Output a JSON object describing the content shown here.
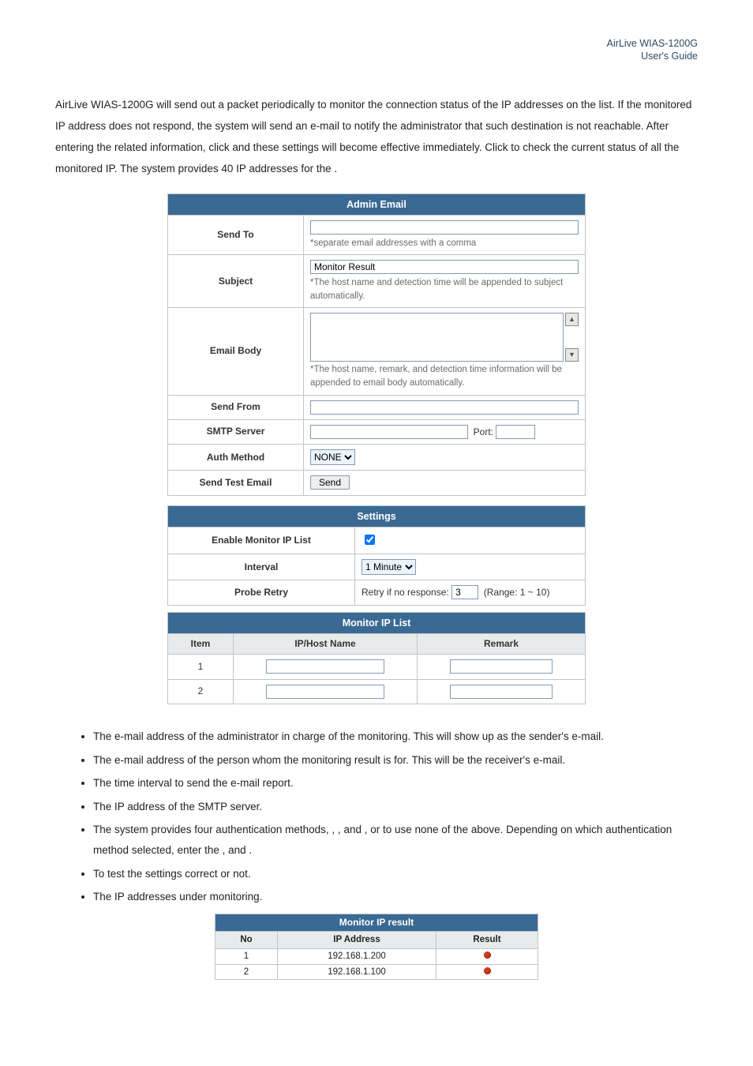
{
  "header": {
    "line1": "AirLive WIAS-1200G",
    "line2": "User's Guide"
  },
  "paragraph": {
    "t1": "AirLive WIAS-1200G will send out a packet periodically to monitor the connection status of the IP addresses on the list. If the monitored IP address does not respond, the system will send an e-mail to notify the administrator that such destination is not reachable. After entering the related information, click ",
    "t2": " and these settings will become effective immediately. Click ",
    "t3": " to check the current status of all the monitored IP. The system provides 40 IP addresses for the ",
    "t4": "."
  },
  "admin": {
    "caption": "Admin Email",
    "sendto_label": "Send To",
    "sendto_hint": "*separate email addresses with a comma",
    "subject_label": "Subject",
    "subject_value": "Monitor Result",
    "subject_hint": "*The host name and detection time will be appended to subject automatically.",
    "body_label": "Email Body",
    "body_hint": "*The host name, remark, and detection time information will be appended to email body automatically.",
    "sendfrom_label": "Send From",
    "smtp_label": "SMTP Server",
    "port_label": "Port:",
    "auth_label": "Auth Method",
    "auth_value": "NONE",
    "test_label": "Send Test Email",
    "test_btn": "Send"
  },
  "settings": {
    "caption": "Settings",
    "enable_label": "Enable Monitor IP List",
    "enable_checked": true,
    "interval_label": "Interval",
    "interval_value": "1 Minute",
    "retry_label": "Probe Retry",
    "retry_prefix": "Retry if no response:",
    "retry_value": "3",
    "retry_range": "(Range: 1 ~ 10)"
  },
  "iplist": {
    "caption": "Monitor IP List",
    "h1": "Item",
    "h2": "IP/Host Name",
    "h3": "Remark",
    "rows": [
      {
        "n": "1"
      },
      {
        "n": "2"
      }
    ]
  },
  "bullets": {
    "b1": " The e-mail address of the administrator in charge of the monitoring. This will show up as the sender's e-mail.",
    "b2": " The e-mail address of the person whom the monitoring result is for. This will be the receiver's e-mail.",
    "b3": " The time interval to send the e-mail report.",
    "b4": " The IP address of the SMTP server.",
    "b5a": " The system provides four authentication methods, ",
    "b5b": ", ",
    "b5c": ", ",
    "b5d": " and ",
    "b5e": ", or ",
    "b5f": " to use none of the above. Depending on which authentication method selected, enter the ",
    "b5g": ", ",
    "b5h": " and ",
    "b5i": ".",
    "b6": " To test the settings correct or not.",
    "b7": " The IP addresses under monitoring."
  },
  "result": {
    "caption": "Monitor IP result",
    "h1": "No",
    "h2": "IP Address",
    "h3": "Result",
    "rows": [
      {
        "n": "1",
        "ip": "192.168.1.200"
      },
      {
        "n": "2",
        "ip": "192.168.1.100"
      }
    ]
  },
  "chart_data": {
    "type": "table",
    "title": "Monitor IP result",
    "columns": [
      "No",
      "IP Address",
      "Result"
    ],
    "rows": [
      [
        "1",
        "192.168.1.200",
        "down"
      ],
      [
        "2",
        "192.168.1.100",
        "down"
      ]
    ]
  }
}
